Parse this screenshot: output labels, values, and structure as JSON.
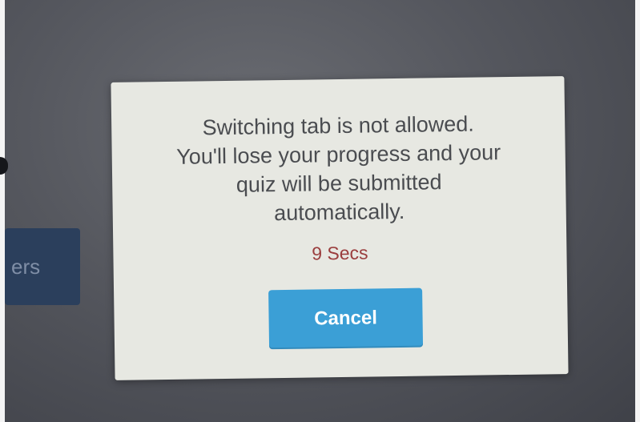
{
  "background": {
    "partial_button_label": "ers"
  },
  "modal": {
    "message": "Switching tab is not allowed.\nYou'll lose your progress and your\nquiz will be submitted\nautomatically.",
    "countdown": "9 Secs",
    "cancel_label": "Cancel"
  },
  "colors": {
    "modal_background": "#e7e8e2",
    "countdown_text": "#9a3d3d",
    "cancel_button": "#3b9fd6",
    "background_button": "#2b3f5c"
  }
}
